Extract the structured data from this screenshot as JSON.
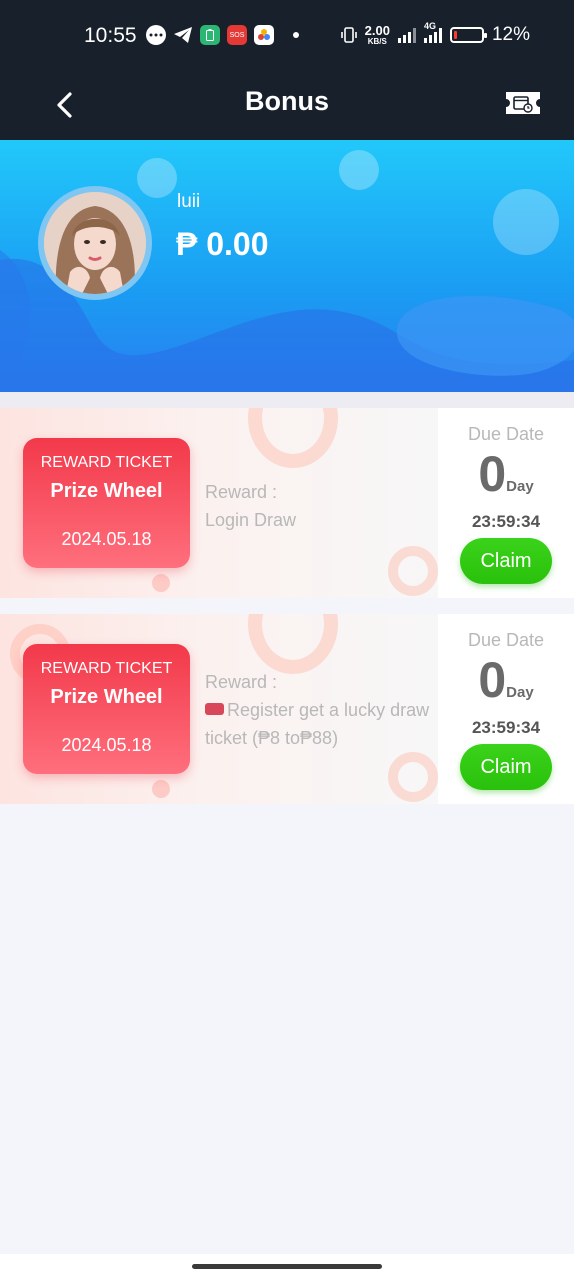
{
  "status_bar": {
    "time": "10:55",
    "net_speed_value": "2.00",
    "net_speed_unit": "KB/S",
    "signal_label": "4G",
    "battery_percent": "12%",
    "battery_level": 0.12
  },
  "header": {
    "title": "Bonus",
    "back_icon": "chevron-left-icon",
    "action_icon": "ticket-icon"
  },
  "profile": {
    "username": "luii",
    "balance": "₱ 0.00"
  },
  "rewards": [
    {
      "ticket_type": "REWARD TICKET",
      "ticket_name": "Prize Wheel",
      "ticket_date": "2024.05.18",
      "reward_label": "Reward :",
      "reward_desc": "Login Draw",
      "due_label": "Due Date",
      "days": "0",
      "days_unit": "Day",
      "countdown": "23:59:34",
      "claim_label": "Claim"
    },
    {
      "ticket_type": "REWARD TICKET",
      "ticket_name": "Prize Wheel",
      "ticket_date": "2024.05.18",
      "reward_label": "Reward :",
      "reward_desc": "Register get a lucky draw ticket (₱8 to₱88)",
      "due_label": "Due Date",
      "days": "0",
      "days_unit": "Day",
      "countdown": "23:59:34",
      "claim_label": "Claim"
    }
  ],
  "colors": {
    "header_bg": "#18202c",
    "hero_blue": "#1a9cf3",
    "ticket_red": "#f2394a",
    "claim_green": "#2fc90f"
  }
}
